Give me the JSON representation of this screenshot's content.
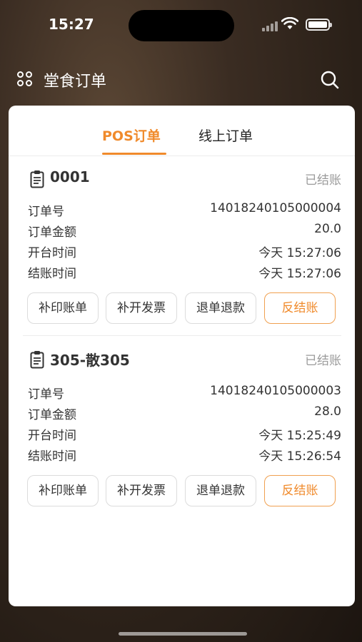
{
  "status_bar": {
    "time": "15:27"
  },
  "nav": {
    "title": "堂食订单",
    "menu_icon": "grid-menu-icon",
    "search_icon": "search-icon"
  },
  "colors": {
    "accent": "#f08a2b",
    "muted": "#9a9a9a"
  },
  "tabs": [
    {
      "label": "POS订单",
      "active": true
    },
    {
      "label": "线上订单",
      "active": false
    }
  ],
  "orders": [
    {
      "name": "0001",
      "status": "已结账",
      "fields": [
        {
          "label": "订单号",
          "value": "14018240105000004"
        },
        {
          "label": "订单金额",
          "value": "20.0"
        },
        {
          "label": "开台时间",
          "value": "今天 15:27:06"
        },
        {
          "label": "结账时间",
          "value": "今天 15:27:06"
        }
      ],
      "actions": [
        "补印账单",
        "补开发票",
        "退单退款",
        "反结账"
      ]
    },
    {
      "name": "305-散305",
      "status": "已结账",
      "fields": [
        {
          "label": "订单号",
          "value": "14018240105000003"
        },
        {
          "label": "订单金额",
          "value": "28.0"
        },
        {
          "label": "开台时间",
          "value": "今天 15:25:49"
        },
        {
          "label": "结账时间",
          "value": "今天 15:26:54"
        }
      ],
      "actions": [
        "补印账单",
        "补开发票",
        "退单退款",
        "反结账"
      ]
    }
  ]
}
